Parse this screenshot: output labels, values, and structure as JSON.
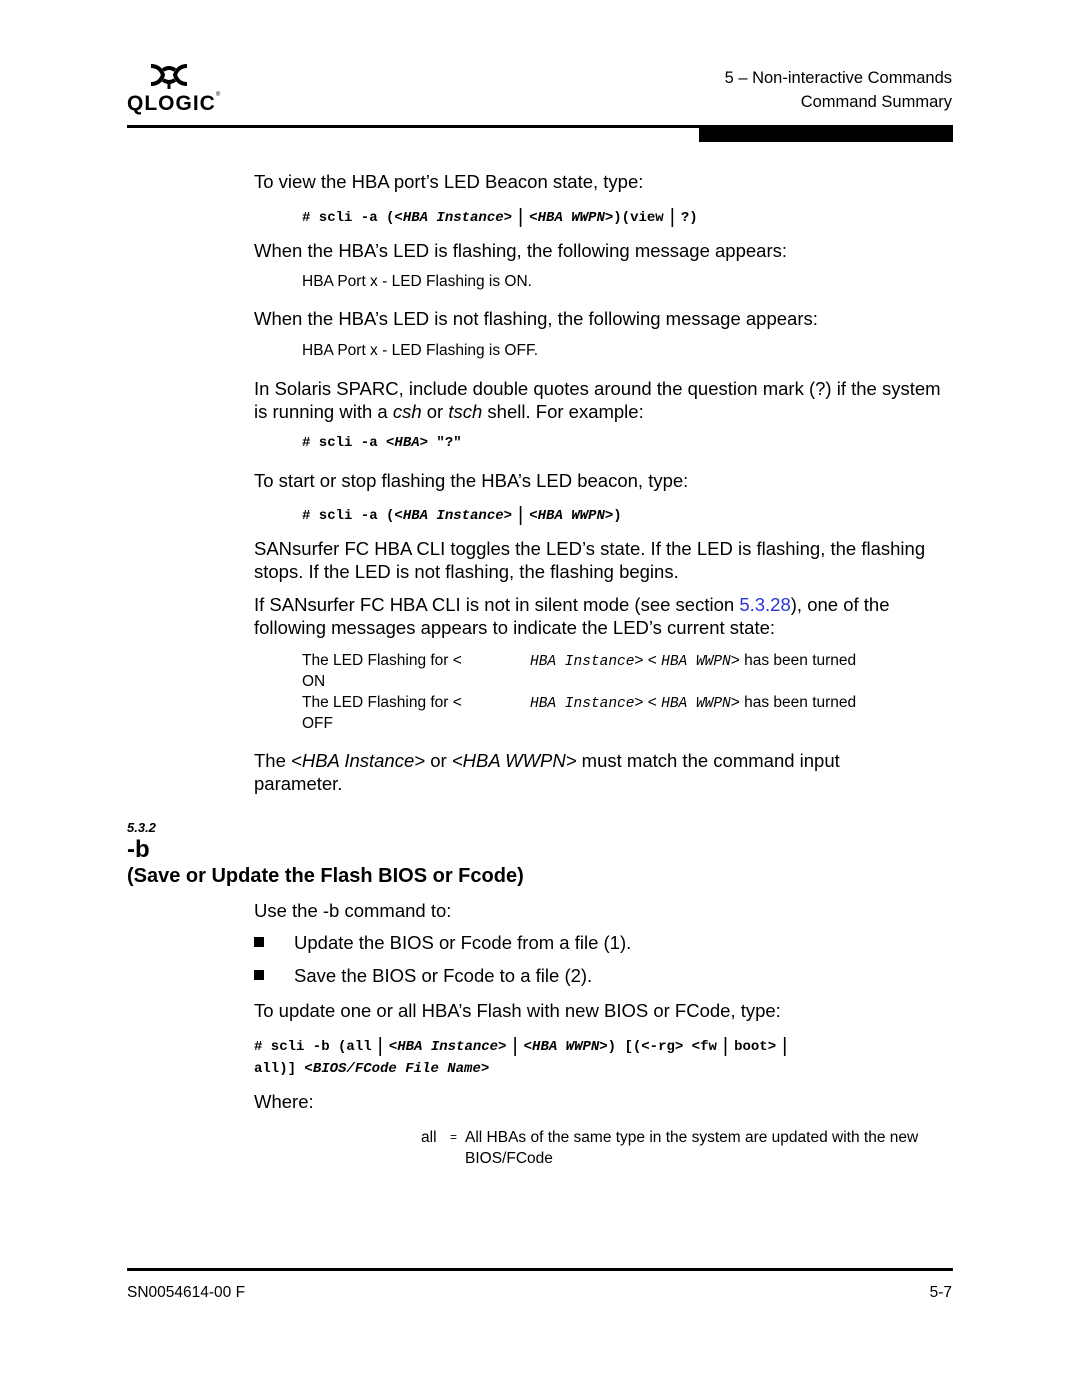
{
  "header": {
    "logo_text": "QLOGIC",
    "logo_reg": "®",
    "chapter": "5 – Non-interactive Commands",
    "section": "Command Summary"
  },
  "content": {
    "p_view_beacon": "To view the HBA port’s LED Beacon state, type:",
    "cmd_view": {
      "prefix": "# scli -a (",
      "arg1": "<HBA Instance>",
      "sep": "|",
      "arg2": "<HBA WWPN>",
      "mid": ")(view",
      "end": "?)"
    },
    "p_flashing": "When the HBA’s LED is flashing, the following message appears:",
    "msg_on": "HBA Port x - LED Flashing is ON.",
    "p_not_flashing": "When the HBA’s LED is not flashing, the following message appears:",
    "msg_off": "HBA Port x - LED Flashing is OFF.",
    "p_solaris_1": "In Solaris SPARC, include double quotes around the question mark (?) if the system is running with a ",
    "p_solaris_csh": "csh",
    "p_solaris_or": " or ",
    "p_solaris_tsch": "tsch",
    "p_solaris_2": " shell. For example:",
    "cmd_solaris": {
      "prefix": "# scli -a ",
      "arg": "<HBA>",
      "suffix": " \"?\""
    },
    "p_start_stop": "To start or stop flashing the HBA’s LED beacon, type:",
    "cmd_toggle": {
      "prefix": "# scli -a (",
      "arg1": "<HBA Instance>",
      "sep": "|",
      "arg2": "<HBA WWPN>",
      "end": ")"
    },
    "p_toggles": "SANsurfer FC HBA CLI toggles the LED’s state. If the LED is flashing, the flashing stops. If the LED is not flashing, the flashing begins.",
    "p_silent_1": "If SANsurfer FC HBA CLI is not in silent mode (see section ",
    "p_silent_link": "5.3.28",
    "p_silent_2": "), one of the following messages appears to indicate the LED’s current state:",
    "state_table": [
      {
        "c1": "The LED Flashing for <",
        "c2a": "HBA Instance",
        "c2b": "> < ",
        "c2c": "HBA WWPN",
        "c2d": "> has been turned",
        "c3": "ON"
      },
      {
        "c1": "The LED Flashing for <",
        "c2a": "HBA Instance",
        "c2b": "> < ",
        "c2c": "HBA WWPN",
        "c2d": "> has been turned",
        "c3": "OFF"
      }
    ],
    "p_match_1": "The ",
    "p_match_arg1": "<HBA Instance>",
    "p_match_or": " or ",
    "p_match_arg2": "<HBA WWPN>",
    "p_match_2": " must match the command input parameter."
  },
  "section": {
    "number": "5.3.2",
    "title_cmd": "-b",
    "title_desc": "(Save or Update the Flash BIOS or Fcode)",
    "p_use": "Use the -b  command to:",
    "bullets": [
      "Update the BIOS or Fcode from a file (1).",
      "Save the BIOS or Fcode to a file (2)."
    ],
    "p_update": "To update one or all HBA’s Flash with new BIOS or FCode, type:",
    "cmd_b": {
      "part1": "# scli -b (all",
      "arg1": "<HBA Instance>",
      "arg2": "<HBA WWPN>",
      "part2": ") [(<-rg> <fw",
      "part3": "boot>",
      "part4": "all)] ",
      "arg3": "<BIOS/FCode File Name>"
    },
    "where_label": "Where:",
    "where_items": [
      {
        "term": "all",
        "eq": "=",
        "def": "All HBAs of the same type in the system are updated with the new BIOS/FCode"
      }
    ]
  },
  "footer": {
    "doc_id": "SN0054614-00  F",
    "page": "5-7"
  },
  "colors": {
    "link": "#2a35d6",
    "text": "#000000"
  }
}
